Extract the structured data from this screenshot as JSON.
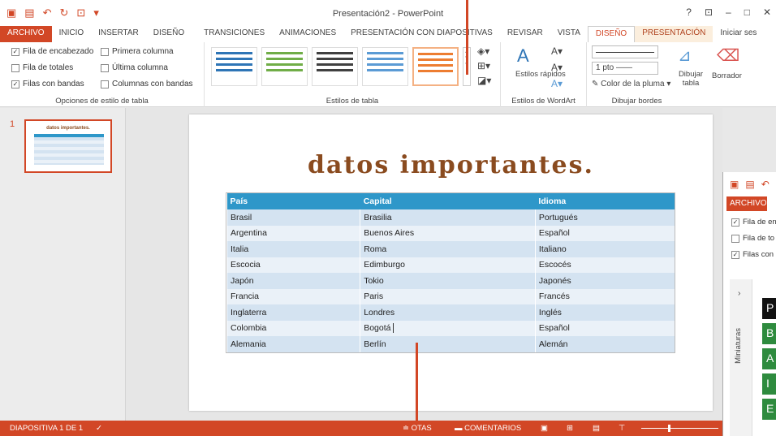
{
  "window": {
    "title": "Presentación2 - PowerPoint",
    "help": "?",
    "controls": [
      "⊡",
      "–",
      "□",
      "✕"
    ]
  },
  "qat": {
    "icons": [
      "ppt-logo-icon",
      "save-icon",
      "undo-icon",
      "redo-icon",
      "start-icon",
      "customize-icon"
    ]
  },
  "tabs": [
    "ARCHIVO",
    "INICIO",
    "INSERTAR",
    "DISEÑO",
    "TRANSICIONES",
    "ANIMACIONES",
    "PRESENTACIÓN CON DIAPOSITIVAS",
    "REVISAR",
    "VISTA",
    "DISEÑO",
    "PRESENTACIÓN",
    "Iniciar ses"
  ],
  "ribbon": {
    "table_style_options": {
      "label": "Opciones de estilo de tabla",
      "options": [
        {
          "label": "Fila de encabezado",
          "checked": true
        },
        {
          "label": "Primera columna",
          "checked": false
        },
        {
          "label": "Fila de totales",
          "checked": false
        },
        {
          "label": "Última columna",
          "checked": false
        },
        {
          "label": "Filas con bandas",
          "checked": true
        },
        {
          "label": "Columnas con bandas",
          "checked": false
        }
      ]
    },
    "table_styles": {
      "label": "Estilos de tabla",
      "swatches": [
        "#2e75b6",
        "#70ad47",
        "#404040",
        "#5b9bd5",
        "#ed7d31"
      ]
    },
    "wordart": {
      "label": "Estilos de WordArt",
      "quick_styles": "Estilos rápidos"
    },
    "borders": {
      "label": "Dibujar bordes",
      "weight": "1 pto",
      "pen_color": "Color de la pluma",
      "draw_table": "Dibujar tabla",
      "eraser": "Borrador"
    }
  },
  "thumbnail": {
    "number": "1",
    "title": "datos importantes."
  },
  "slide": {
    "title": "datos importantes.",
    "table": {
      "headers": [
        "País",
        "Capital",
        "Idioma"
      ],
      "rows": [
        [
          "Brasil",
          "Brasilia",
          "Portugués"
        ],
        [
          "Argentina",
          "Buenos Aires",
          "Español"
        ],
        [
          "Italia",
          "Roma",
          "Italiano"
        ],
        [
          "Escocia",
          "Edimburgo",
          "Escocés"
        ],
        [
          "Japón",
          "Tokio",
          "Japonés"
        ],
        [
          "Francia",
          "Paris",
          "Francés"
        ],
        [
          "Inglaterra",
          "Londres",
          "Inglés"
        ],
        [
          "Colombia",
          "Bogotá",
          "Español"
        ],
        [
          "Alemania",
          "Berlín",
          "Alemán"
        ]
      ]
    }
  },
  "status": {
    "slide_count": "DIAPOSITIVA 1 DE 1",
    "notes": "OTAS",
    "comments": "COMENTARIOS"
  },
  "overlay": {
    "file_tab": "ARCHIVO",
    "options": [
      "Fila de en",
      "Fila de to",
      "Filas con"
    ],
    "options_checked": [
      true,
      false,
      true
    ],
    "sidebar_label": "Miniaturas",
    "cells": [
      "P",
      "B",
      "A",
      "I",
      "E"
    ],
    "cell_colors": [
      "#111111",
      "#2e8b3e",
      "#2e8b3e",
      "#2e8b3e",
      "#2e8b3e"
    ]
  },
  "colors": {
    "accent": "#d24726",
    "table_header": "#2e97c9"
  }
}
